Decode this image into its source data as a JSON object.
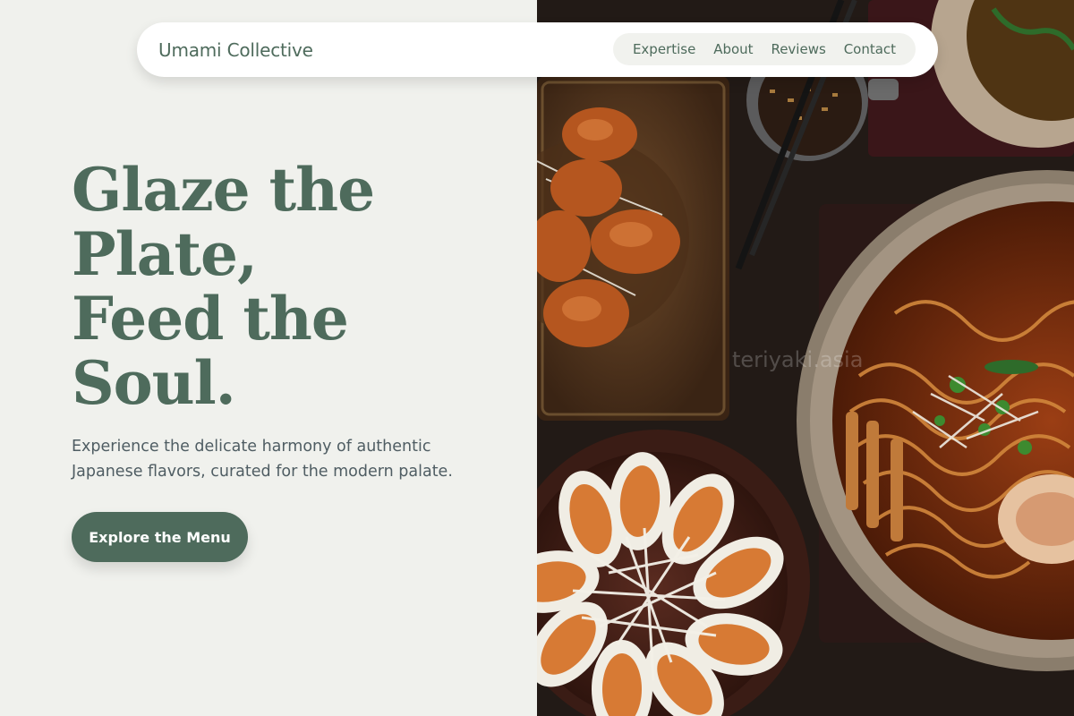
{
  "nav": {
    "brand": "Umami Collective",
    "links": [
      "Expertise",
      "About",
      "Reviews",
      "Contact"
    ]
  },
  "hero": {
    "headline_lines": [
      "Glaze the",
      "Plate,",
      "Feed the",
      "Soul."
    ],
    "subtitle": "Experience the delicate harmony of authentic Japanese flavors, curated for the modern palate.",
    "cta_label": "Explore the Menu"
  },
  "image": {
    "watermark": "teriyaki.asia",
    "depicts": [
      "karaage-plate",
      "dipping-sauce-bowl",
      "chopsticks",
      "ramen-bowl",
      "gyoza-plate"
    ]
  },
  "colors": {
    "accent": "#4e6b5c",
    "background": "#f0f1ed",
    "body_text": "#4f5d63",
    "nav_bg": "#ffffff"
  }
}
